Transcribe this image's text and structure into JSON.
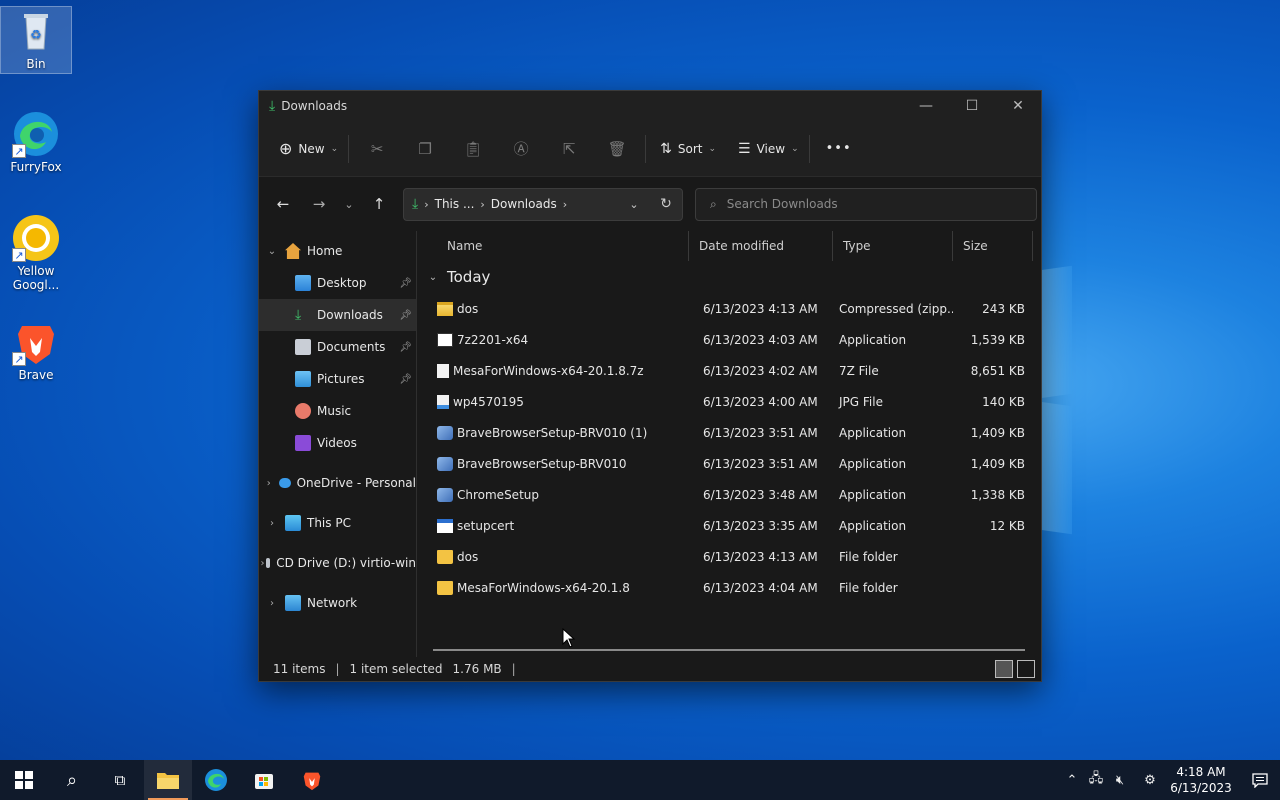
{
  "desktop": {
    "icons": [
      {
        "label": "Bin",
        "icon": "recycle-bin-icon"
      },
      {
        "label": "FurryFox",
        "icon": "edge-icon"
      },
      {
        "label": "Yellow Googl...",
        "icon": "chrome-yellow-icon"
      },
      {
        "label": "Brave",
        "icon": "brave-lion-icon"
      }
    ]
  },
  "window": {
    "title": "Downloads",
    "controls": {
      "minimize": "—",
      "maximize": "☐",
      "close": "✕"
    }
  },
  "toolbar": {
    "new_label": "New",
    "sort_label": "Sort",
    "view_label": "View",
    "more_label": "•••"
  },
  "address": {
    "segment_1": "This ...",
    "segment_2": "Downloads"
  },
  "search": {
    "placeholder": "Search Downloads"
  },
  "sidebar": {
    "home": "Home",
    "quick": [
      {
        "label": "Desktop"
      },
      {
        "label": "Downloads"
      },
      {
        "label": "Documents"
      },
      {
        "label": "Pictures"
      },
      {
        "label": "Music"
      },
      {
        "label": "Videos"
      }
    ],
    "drives": [
      {
        "label": "OneDrive - Personal"
      },
      {
        "label": "This PC"
      },
      {
        "label": "CD Drive (D:) virtio-win"
      },
      {
        "label": "Network"
      }
    ]
  },
  "columns": {
    "name": "Name",
    "date": "Date modified",
    "type": "Type",
    "size": "Size"
  },
  "group_label": "Today",
  "files": [
    {
      "name": "dos",
      "date": "6/13/2023 4:13 AM",
      "type": "Compressed (zipp...",
      "size": "243 KB",
      "icon": "zip-folder-icon"
    },
    {
      "name": "7z2201-x64",
      "date": "6/13/2023 4:03 AM",
      "type": "Application",
      "size": "1,539 KB",
      "icon": "7zip-app-icon"
    },
    {
      "name": "MesaForWindows-x64-20.1.8.7z",
      "date": "6/13/2023 4:02 AM",
      "type": "7Z File",
      "size": "8,651 KB",
      "icon": "blank-file-icon"
    },
    {
      "name": "wp4570195",
      "date": "6/13/2023 4:00 AM",
      "type": "JPG File",
      "size": "140 KB",
      "icon": "image-file-icon"
    },
    {
      "name": "BraveBrowserSetup-BRV010 (1)",
      "date": "6/13/2023 3:51 AM",
      "type": "Application",
      "size": "1,409 KB",
      "icon": "installer-icon"
    },
    {
      "name": "BraveBrowserSetup-BRV010",
      "date": "6/13/2023 3:51 AM",
      "type": "Application",
      "size": "1,409 KB",
      "icon": "installer-icon"
    },
    {
      "name": "ChromeSetup",
      "date": "6/13/2023 3:48 AM",
      "type": "Application",
      "size": "1,338 KB",
      "icon": "installer-icon"
    },
    {
      "name": "setupcert",
      "date": "6/13/2023 3:35 AM",
      "type": "Application",
      "size": "12 KB",
      "icon": "app-window-icon"
    },
    {
      "name": "dos",
      "date": "6/13/2023 4:13 AM",
      "type": "File folder",
      "size": "",
      "icon": "folder-icon"
    },
    {
      "name": "MesaForWindows-x64-20.1.8",
      "date": "6/13/2023 4:04 AM",
      "type": "File folder",
      "size": "",
      "icon": "folder-icon"
    }
  ],
  "status": {
    "items": "11 items",
    "selected": "1 item selected",
    "size": "1.76 MB"
  },
  "taskbar": {
    "time": "4:18 AM",
    "date": "6/13/2023"
  },
  "colors": {
    "accent_folder": "#f3c343",
    "download_green": "#3fbf6a",
    "window_bg": "#191919"
  }
}
